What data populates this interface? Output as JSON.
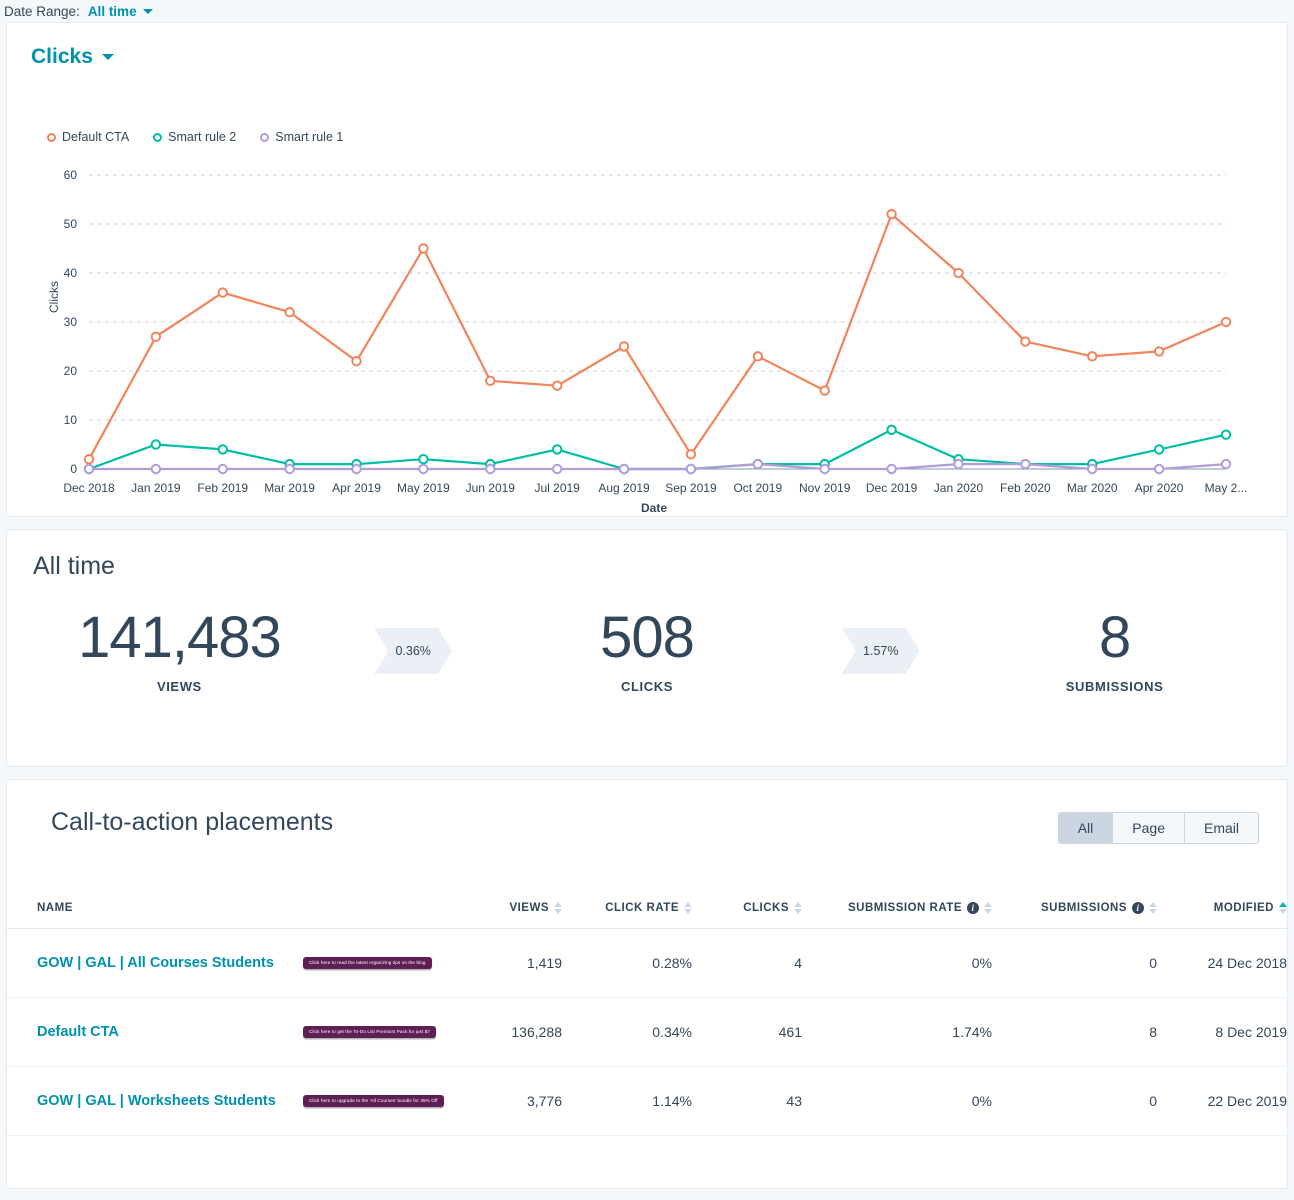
{
  "topbar": {
    "label": "Date Range:",
    "value": "All time"
  },
  "chart_panel": {
    "title": "Clicks"
  },
  "chart_data": {
    "type": "line",
    "title": "Clicks",
    "xlabel": "Date",
    "ylabel": "Clicks",
    "ylim": [
      0,
      60
    ],
    "yticks": [
      0,
      10,
      20,
      30,
      40,
      50,
      60
    ],
    "grid": true,
    "legend_position": "top-left",
    "categories": [
      "Dec 2018",
      "Jan 2019",
      "Feb 2019",
      "Mar 2019",
      "Apr 2019",
      "May 2019",
      "Jun 2019",
      "Jul 2019",
      "Aug 2019",
      "Sep 2019",
      "Oct 2019",
      "Nov 2019",
      "Dec 2019",
      "Jan 2020",
      "Feb 2020",
      "Mar 2020",
      "Apr 2020",
      "May 2..."
    ],
    "series": [
      {
        "name": "Default CTA",
        "color": "#f2845c",
        "values": [
          2,
          27,
          36,
          32,
          22,
          45,
          18,
          17,
          25,
          3,
          23,
          16,
          52,
          40,
          26,
          23,
          24,
          30
        ]
      },
      {
        "name": "Smart rule 2",
        "color": "#00bda5",
        "values": [
          0,
          5,
          4,
          1,
          1,
          2,
          1,
          4,
          0,
          0,
          1,
          1,
          8,
          2,
          1,
          1,
          4,
          7
        ]
      },
      {
        "name": "Smart rule 1",
        "color": "#b39bd9",
        "values": [
          0,
          0,
          0,
          0,
          0,
          0,
          0,
          0,
          0,
          0,
          1,
          0,
          0,
          1,
          1,
          0,
          0,
          1
        ]
      }
    ]
  },
  "stats": {
    "title": "All time",
    "items": [
      {
        "value": "141,483",
        "label": "VIEWS"
      },
      {
        "value": "508",
        "label": "CLICKS"
      },
      {
        "value": "8",
        "label": "SUBMISSIONS"
      }
    ],
    "rates": [
      "0.36%",
      "1.57%"
    ]
  },
  "placements": {
    "title": "Call-to-action placements",
    "filters": [
      {
        "label": "All",
        "active": true
      },
      {
        "label": "Page",
        "active": false
      },
      {
        "label": "Email",
        "active": false
      }
    ],
    "columns": [
      {
        "key": "name",
        "label": "NAME",
        "sortable": false,
        "info": false
      },
      {
        "key": "views",
        "label": "VIEWS",
        "sortable": true,
        "info": false
      },
      {
        "key": "click_rate",
        "label": "CLICK RATE",
        "sortable": true,
        "info": false
      },
      {
        "key": "clicks",
        "label": "CLICKS",
        "sortable": true,
        "info": false
      },
      {
        "key": "submission_rate",
        "label": "SUBMISSION RATE",
        "sortable": true,
        "info": true
      },
      {
        "key": "submissions",
        "label": "SUBMISSIONS",
        "sortable": true,
        "info": true
      },
      {
        "key": "modified",
        "label": "MODIFIED",
        "sortable": true,
        "info": false,
        "sorted": "asc"
      }
    ],
    "rows": [
      {
        "name": "GOW | GAL | All Courses Students",
        "preview": "Click here to read the latest organizing tips on the blog",
        "views": "1,419",
        "click_rate": "0.28%",
        "clicks": "4",
        "submission_rate": "0%",
        "submissions": "0",
        "modified": "24 Dec 2018"
      },
      {
        "name": "Default CTA",
        "preview": "Click here to get the To-Do List Premium Pack for just $7",
        "views": "136,288",
        "click_rate": "0.34%",
        "clicks": "461",
        "submission_rate": "1.74%",
        "submissions": "8",
        "modified": "8 Dec 2019"
      },
      {
        "name": "GOW | GAL | Worksheets Students",
        "preview": "Click here to upgrade to the 'All Courses' bundle for 35% Off",
        "views": "3,776",
        "click_rate": "1.14%",
        "clicks": "43",
        "submission_rate": "0%",
        "submissions": "0",
        "modified": "22 Dec 2019"
      }
    ]
  }
}
